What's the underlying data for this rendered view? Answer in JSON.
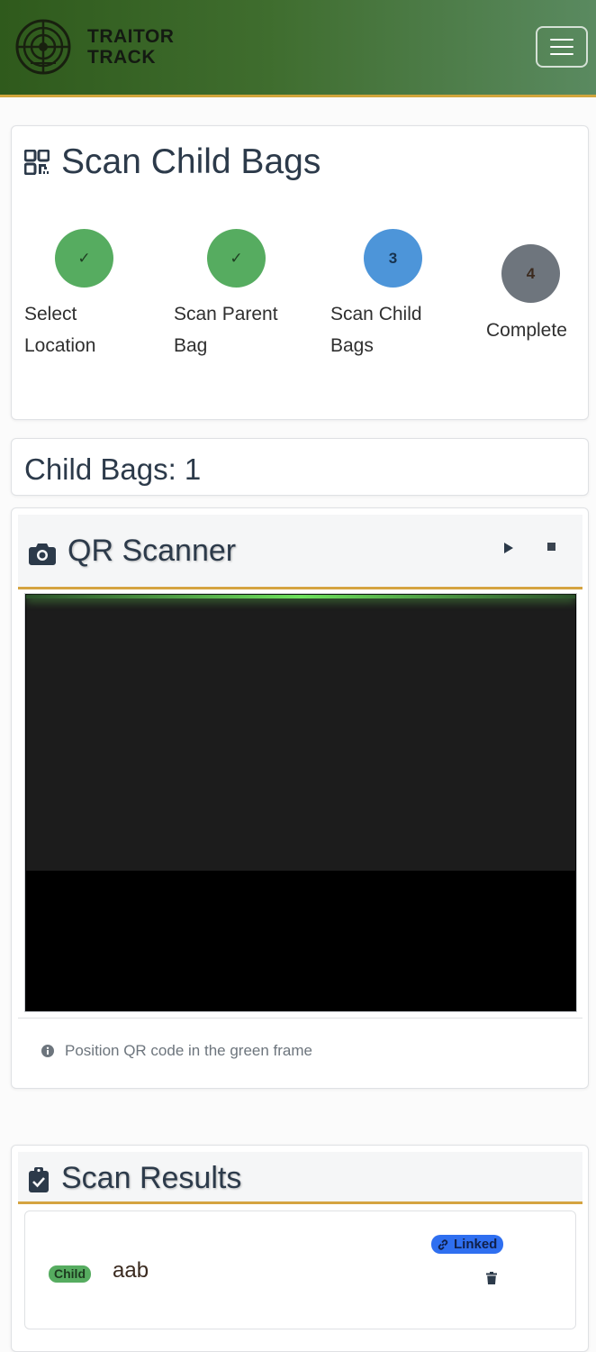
{
  "navbar": {
    "brand_line1": "TRAITOR",
    "brand_line2": "TRACK",
    "brand_color": "#2f5a1c",
    "accent_color": "#d2a63c",
    "menu_icon": "hamburger-icon"
  },
  "progress": {
    "title": "Scan Child Bags",
    "title_icon": "qrcode-icon",
    "steps": [
      {
        "marker": "✓",
        "label_line1": "Select",
        "label_line2": "Location",
        "state": "done"
      },
      {
        "marker": "✓",
        "label_line1": "Scan Parent",
        "label_line2": "Bag",
        "state": "done"
      },
      {
        "marker": "3",
        "label_line1": "Scan Child",
        "label_line2": "Bags",
        "state": "active"
      },
      {
        "marker": "4",
        "label_line1": "Complete",
        "label_line2": "",
        "state": "pending"
      }
    ]
  },
  "child_count": {
    "text": "Child Bags: 1"
  },
  "scanner": {
    "title": "QR Scanner",
    "title_icon": "camera-icon",
    "play_icon": "play-icon",
    "stop_icon": "stop-icon",
    "hint": "Position QR code in the green frame",
    "hint_icon": "info-circle-icon"
  },
  "results": {
    "title": "Scan Results",
    "title_icon": "clipboard-check-icon",
    "items": [
      {
        "type_badge": "Child",
        "code": "aab",
        "status_badge": "Linked",
        "status_icon": "link-icon",
        "action_icon": "trash-icon"
      }
    ]
  }
}
